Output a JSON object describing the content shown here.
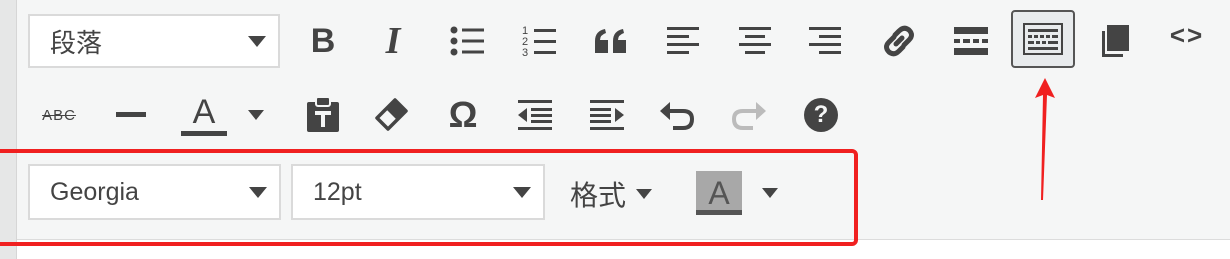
{
  "toolbar": {
    "paragraph_select": {
      "value": "段落"
    },
    "row1_buttons": [
      "bold",
      "italic",
      "bulleted-list",
      "numbered-list",
      "blockquote",
      "align-left",
      "align-center",
      "align-right",
      "insert-link",
      "read-more",
      "toolbar-toggle",
      "copy",
      "code"
    ],
    "row2_buttons": [
      "strikethrough",
      "horizontal-line",
      "text-color",
      "paste-as-text",
      "clear-formatting",
      "special-character",
      "outdent",
      "indent",
      "undo",
      "redo",
      "help"
    ],
    "italic_glyph": "I",
    "bold_glyph": "B",
    "text_color_glyph": "A",
    "strikethrough_glyph": "ABC",
    "omega_glyph": "Ω",
    "help_glyph": "?",
    "code_glyph": "<>",
    "quote_glyph": "❝",
    "numbered_digits": [
      "1",
      "2",
      "3"
    ]
  },
  "advanced": {
    "font_family": {
      "value": "Georgia"
    },
    "font_size": {
      "value": "12pt"
    },
    "formats_label": "格式",
    "bg_color_glyph": "A"
  },
  "colors": {
    "highlight": "#f02020",
    "icon": "#444444"
  }
}
